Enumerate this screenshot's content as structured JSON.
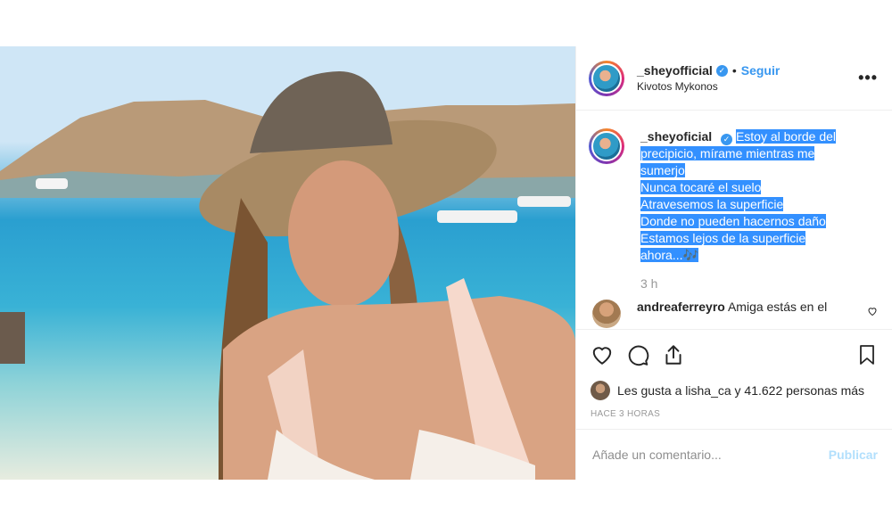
{
  "post": {
    "username": "_sheyofficial",
    "follow_label": "Seguir",
    "separator": "•",
    "location": "Kivotos Mykonos",
    "more_label": "•••",
    "caption_username": "_sheyoficial",
    "caption_lines": [
      "Estoy al borde del",
      "precipicio, mírame mientras me",
      "sumerjo",
      "Nunca tocaré el suelo",
      "Atravesemos la superficie",
      "Donde no pueden hacernos daño",
      "Estamos lejos de la superficie",
      "ahora..."
    ],
    "caption_emoji": "🎶",
    "caption_time": "3 h",
    "comment": {
      "username": "andreaferreyro",
      "text": "Amiga estás en el"
    },
    "likes_text": "Les gusta a lisha_ca y 41.622 personas más",
    "posted_ago": "HACE 3 HORAS",
    "add_comment_placeholder": "Añade un comentario...",
    "publish_label": "Publicar"
  },
  "icons": {
    "like": "heart-icon",
    "comment": "comment-icon",
    "share": "share-icon",
    "save": "bookmark-icon",
    "verified": "verified-badge-icon"
  },
  "colors": {
    "accent": "#3897f0",
    "highlight": "#3390ff",
    "publish_disabled": "#b2dffc"
  }
}
